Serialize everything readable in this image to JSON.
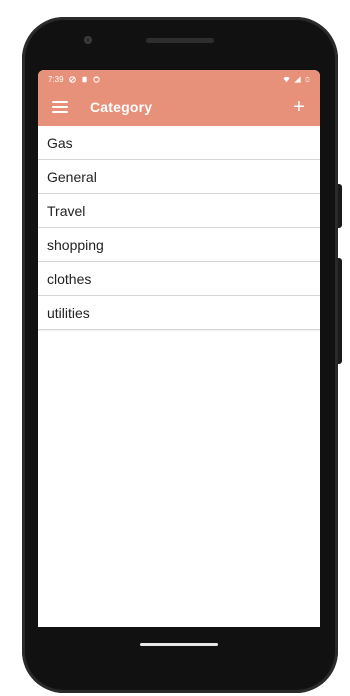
{
  "status_bar": {
    "time": "7:39"
  },
  "app_bar": {
    "title": "Category",
    "add_symbol": "+"
  },
  "categories": [
    {
      "label": "Gas"
    },
    {
      "label": "General"
    },
    {
      "label": "Travel"
    },
    {
      "label": "shopping"
    },
    {
      "label": "clothes"
    },
    {
      "label": "utilities"
    }
  ],
  "icons": {
    "menu": "menu-icon",
    "add": "add-icon",
    "wifi": "wifi-icon",
    "signal": "signal-icon",
    "battery": "battery-icon"
  },
  "colors": {
    "accent": "#e7907a",
    "on_accent": "#ffffff",
    "divider": "#d6d6d6"
  }
}
